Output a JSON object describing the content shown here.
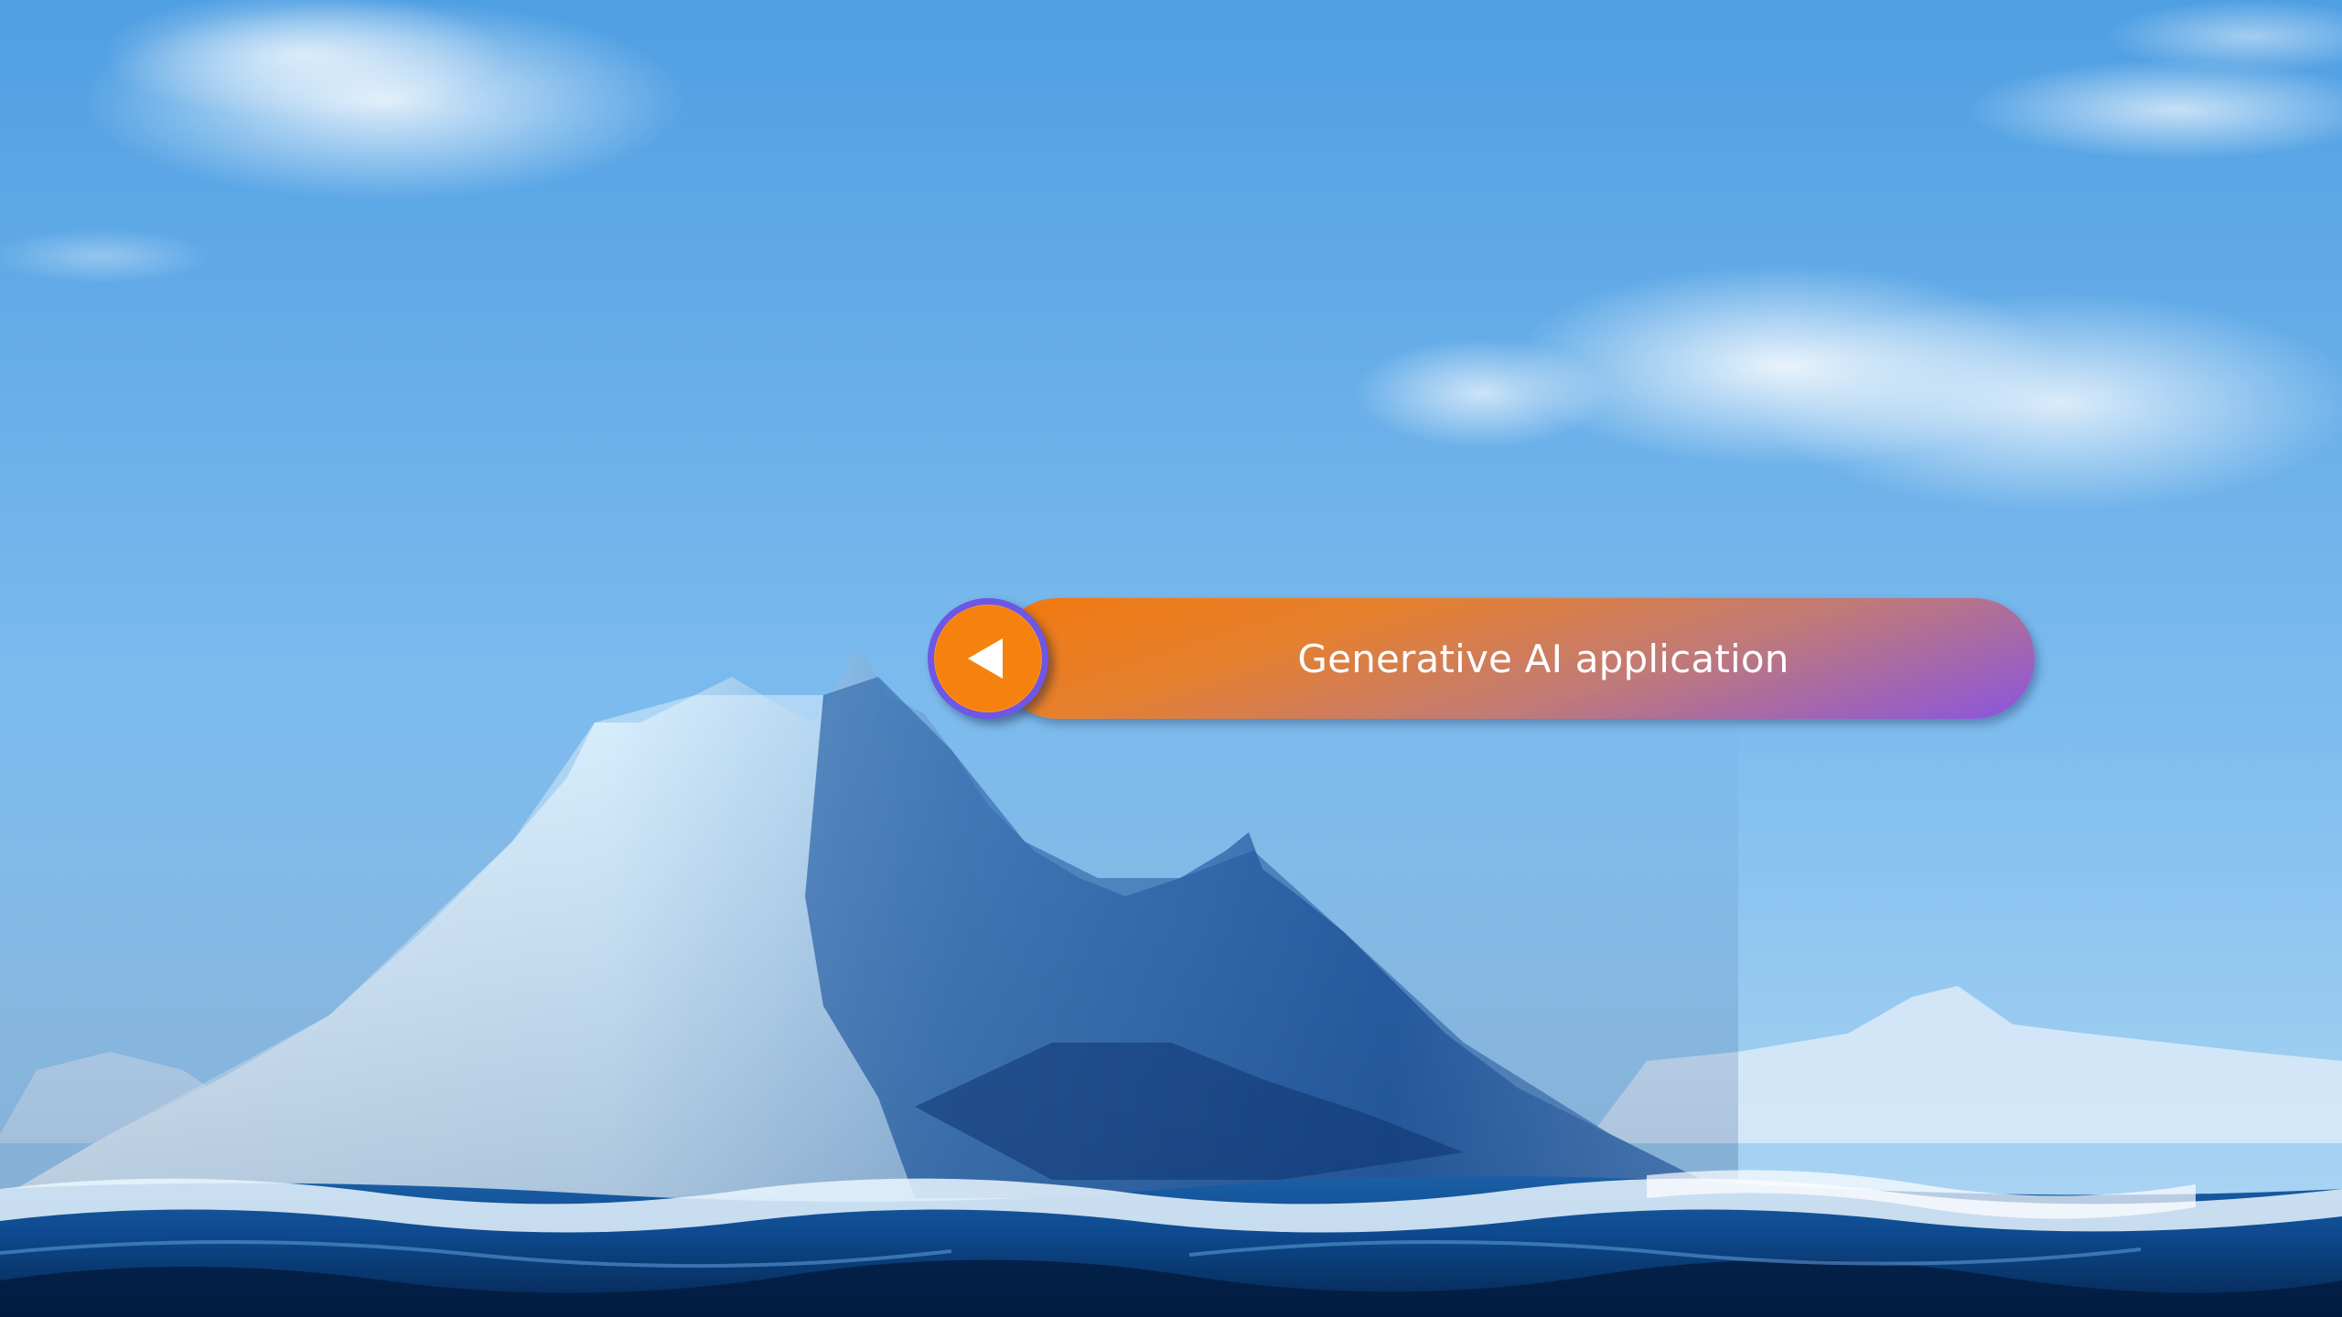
{
  "slide": {
    "button_label": "Generative AI application",
    "back_icon": "play-left-icon"
  },
  "colors": {
    "sky_top": "#5aa9e8",
    "sky_bottom": "#a9d3f2",
    "ocean": "#0a3d7a",
    "pill_start": "#f1790f",
    "pill_end": "#8a55df",
    "button_fill": "#f5820f",
    "button_ring": "#6e56e6"
  }
}
